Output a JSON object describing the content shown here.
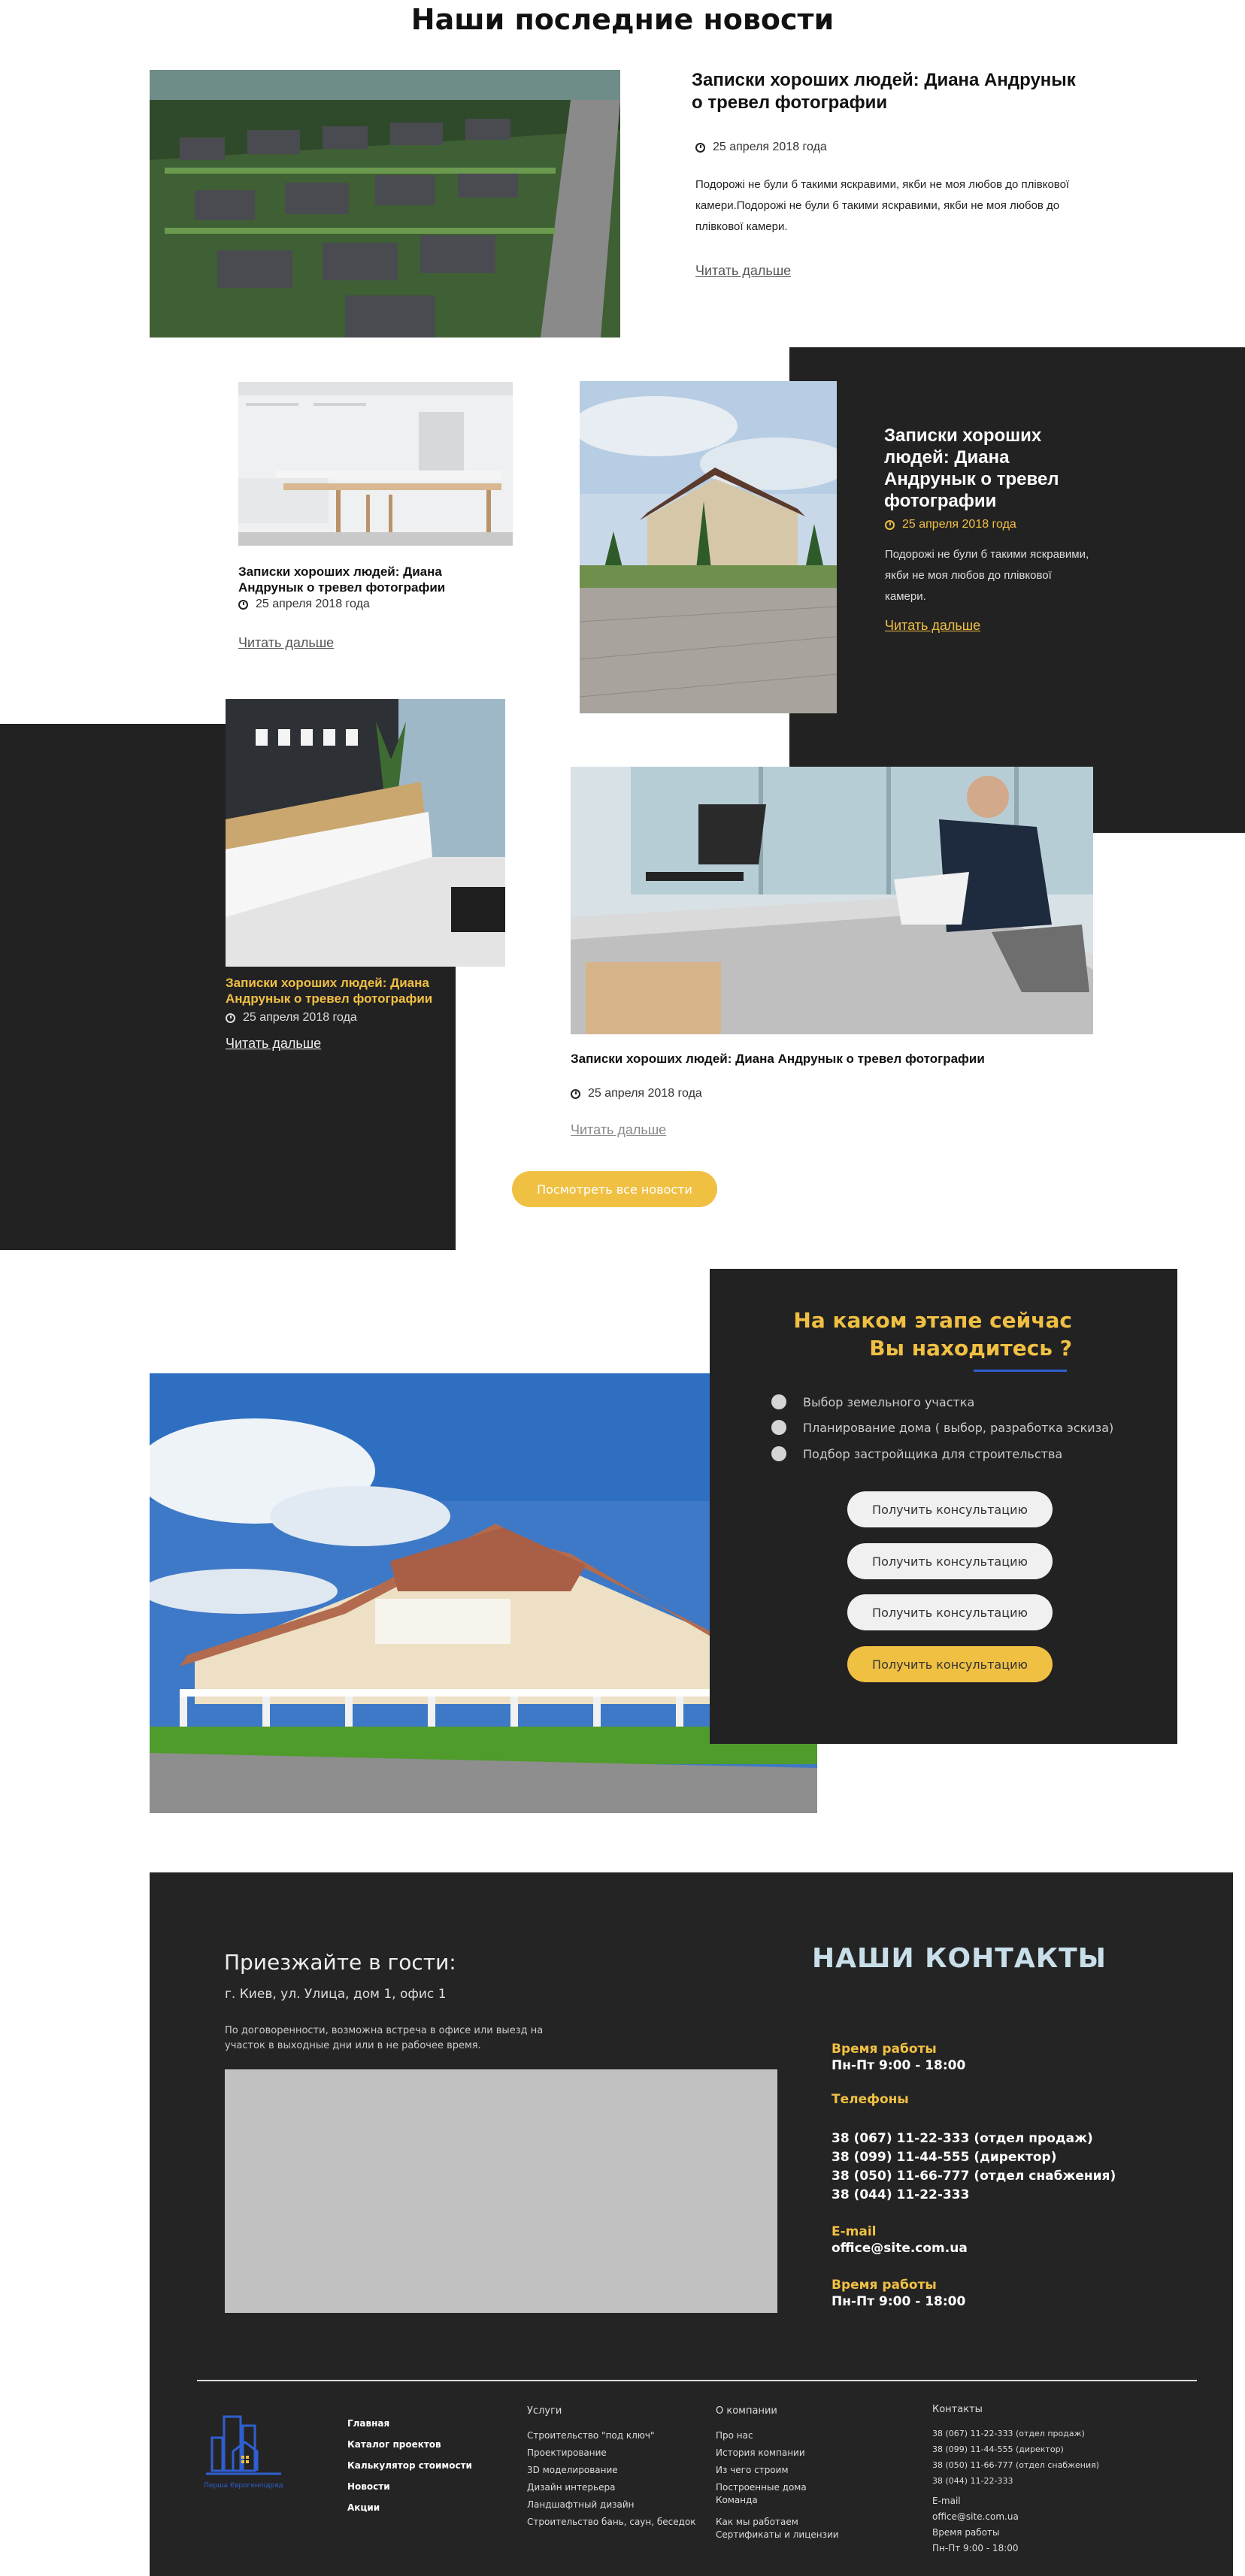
{
  "news": {
    "heading": "Наши последние новости",
    "featured": {
      "title": "Записки хороших людей: Диана Андрунык о тревел фотографии",
      "date": "25 апреля 2018 года",
      "text": "Подорожі не були б такими яскравими, якби не моя любов до плівкової камери.Подорожі не були б такими яскравими, якби не моя любов до плівкової камери.",
      "more": "Читать дальше"
    },
    "card_kitchen": {
      "title": "Записки хороших людей: Диана Андрунык о тревел фотографии",
      "date": "25 апреля 2018 года",
      "more": "Читать дальше"
    },
    "card_house": {
      "title": "Записки хороших людей: Диана Андрунык о тревел фотографии",
      "date": "25 апреля 2018 года",
      "text": "Подорожі не були б такими яскравими, якби не моя любов до плівкової камери.",
      "more": "Читать дальше"
    },
    "card_reception": {
      "title": "Записки хороших людей: Диана Андрунык о тревел фотографии",
      "date": "25 апреля 2018 года",
      "more": "Читать дальше"
    },
    "card_office": {
      "title": "Записки хороших людей: Диана Андрунык о тревел фотографии",
      "date": "25 апреля 2018 года",
      "more": "Читать дальше"
    },
    "all_button": "Посмотреть все новости"
  },
  "stage": {
    "title_line1": "На каком этапе сейчас",
    "title_line2": "Вы находитесь ?",
    "options": [
      "Выбор земельного участка",
      "Планирование дома ( выбор, разработка эскиза)",
      "Подбор застройщика для строительства"
    ],
    "buttons": [
      "Получить консультацию",
      "Получить консультацию",
      "Получить консультацию",
      "Получить консультацию"
    ]
  },
  "contacts": {
    "visit_title": "Приезжайте в гости:",
    "address": "г. Киев, ул. Улица, дом 1, офис 1",
    "note": "По договоренности, возможна встреча в офисе или выезд на участок в выходные дни или в не рабочее время.",
    "heading": "НАШИ КОНТАКТЫ",
    "hours_label": "Время работы",
    "hours": "Пн-Пт 9:00 - 18:00",
    "phones_label": "Телефоны",
    "phones": [
      "38 (067) 11-22-333 (отдел продаж)",
      "38 (099) 11-44-555 (директор)",
      "38 (050) 11-66-777 (отдел снабжения)",
      "38 (044) 11-22-333"
    ],
    "email_label": "E-mail",
    "email": "office@site.com.ua",
    "hours_label2": "Время работы",
    "hours2": "Пн-Пт 9:00 - 18:00"
  },
  "footer": {
    "logo_text": "Перша Єврогенпідряд",
    "main_nav": [
      "Главная",
      "Каталог проектов",
      "Калькулятор стоимости",
      "Новости",
      "Акции"
    ],
    "services_title": "Услуги",
    "services": [
      "Строительство \"под ключ\"",
      "Проектирование",
      "3D моделирование",
      "Дизайн интерьера",
      "Ландшафтный дизайн",
      "Строительство бань, саун, беседок"
    ],
    "company_title": "О компании",
    "company": [
      "Про нас",
      "История компании",
      "Из чего строим",
      "Построенные дома",
      "Команда",
      "Как мы работаем",
      "Сертификаты и лицензии"
    ],
    "contacts_title": "Контакты",
    "phones": [
      "38 (067) 11-22-333 (отдел продаж)",
      "38 (099) 11-44-555 (директор)",
      "38 (050) 11-66-777 (отдел снабжения)",
      "38 (044) 11-22-333"
    ],
    "email_label": "E-mail",
    "email": "office@site.com.ua",
    "hours_label": "Время работы",
    "hours": "Пн-Пт 9:00 - 18:00"
  },
  "colors": {
    "accent": "#f0c043",
    "dark": "#232223",
    "blue": "#2e5fd0",
    "contacts_heading": "#c8dfe9"
  }
}
